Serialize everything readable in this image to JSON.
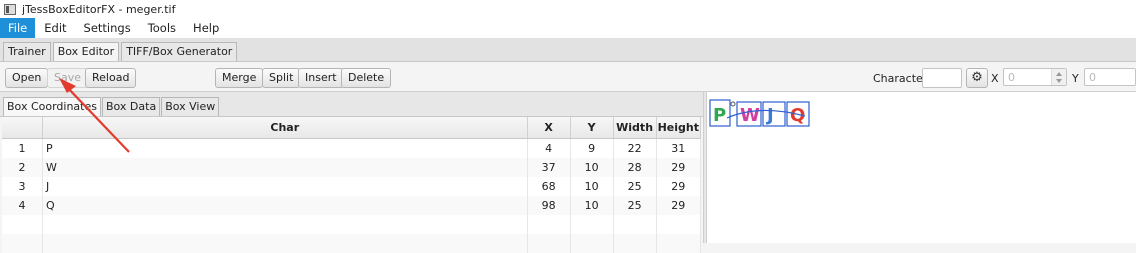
{
  "window": {
    "title": "jTessBoxEditorFX - meger.tif"
  },
  "menu": [
    "File",
    "Edit",
    "Settings",
    "Tools",
    "Help"
  ],
  "main_tabs": [
    "Trainer",
    "Box Editor",
    "TIFF/Box Generator"
  ],
  "toolbar": {
    "open": "Open",
    "save": "Save",
    "reload": "Reload",
    "merge": "Merge",
    "split": "Split",
    "insert": "Insert",
    "delete": "Delete",
    "character_label": "Character",
    "x_label": "X",
    "x_value": "0",
    "y_label": "Y",
    "y_value": "0"
  },
  "sub_tabs": [
    "Box Coordinates",
    "Box Data",
    "Box View"
  ],
  "table": {
    "headers": [
      "Char",
      "X",
      "Y",
      "Width",
      "Height"
    ],
    "rows": [
      {
        "n": "1",
        "char": "P",
        "x": "4",
        "y": "9",
        "w": "22",
        "h": "31"
      },
      {
        "n": "2",
        "char": "W",
        "x": "37",
        "y": "10",
        "w": "28",
        "h": "29"
      },
      {
        "n": "3",
        "char": "J",
        "x": "68",
        "y": "10",
        "w": "25",
        "h": "29"
      },
      {
        "n": "4",
        "char": "Q",
        "x": "98",
        "y": "10",
        "w": "25",
        "h": "29"
      }
    ]
  },
  "preview_text": [
    "P",
    "W",
    "J",
    "Q"
  ],
  "colors": {
    "menu_active": "#1e90d9",
    "arrow": "#e23b2e",
    "box_outline": "#2f5fd0"
  }
}
